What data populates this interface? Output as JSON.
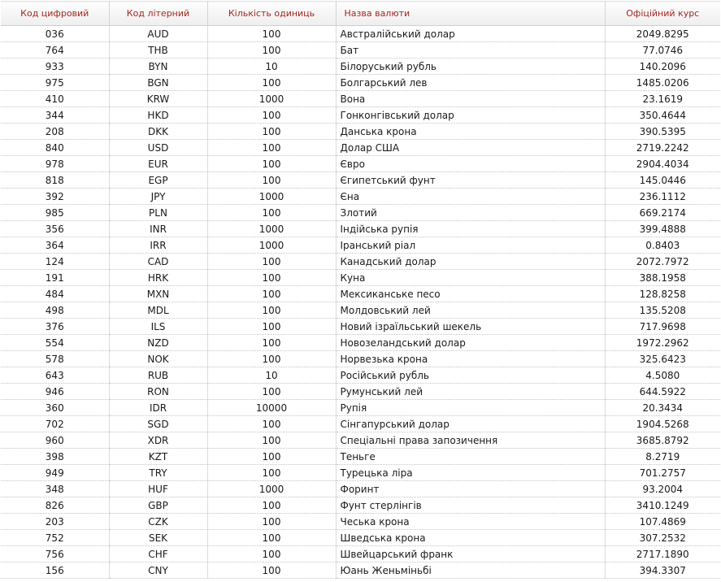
{
  "table": {
    "headers": [
      "Код цифровий",
      "Код літерний",
      "Кількість одиниць",
      "Назва валюти",
      "Офіційний курс"
    ],
    "rows": [
      [
        "036",
        "AUD",
        "100",
        "Австралійський долар",
        "2049.8295"
      ],
      [
        "764",
        "THB",
        "100",
        "Бат",
        "77.0746"
      ],
      [
        "933",
        "BYN",
        "10",
        "Білоруський рубль",
        "140.2096"
      ],
      [
        "975",
        "BGN",
        "100",
        "Болгарський лев",
        "1485.0206"
      ],
      [
        "410",
        "KRW",
        "1000",
        "Вона",
        "23.1619"
      ],
      [
        "344",
        "HKD",
        "100",
        "Гонконгівський долар",
        "350.4644"
      ],
      [
        "208",
        "DKK",
        "100",
        "Данська крона",
        "390.5395"
      ],
      [
        "840",
        "USD",
        "100",
        "Долар США",
        "2719.2242"
      ],
      [
        "978",
        "EUR",
        "100",
        "Євро",
        "2904.4034"
      ],
      [
        "818",
        "EGP",
        "100",
        "Єгипетський фунт",
        "145.0446"
      ],
      [
        "392",
        "JPY",
        "1000",
        "Єна",
        "236.1112"
      ],
      [
        "985",
        "PLN",
        "100",
        "Злотий",
        "669.2174"
      ],
      [
        "356",
        "INR",
        "1000",
        "Індійська рупія",
        "399.4888"
      ],
      [
        "364",
        "IRR",
        "1000",
        "Іранський ріал",
        "0.8403"
      ],
      [
        "124",
        "CAD",
        "100",
        "Канадський долар",
        "2072.7972"
      ],
      [
        "191",
        "HRK",
        "100",
        "Куна",
        "388.1958"
      ],
      [
        "484",
        "MXN",
        "100",
        "Мексиканське песо",
        "128.8258"
      ],
      [
        "498",
        "MDL",
        "100",
        "Молдовський лей",
        "135.5208"
      ],
      [
        "376",
        "ILS",
        "100",
        "Новий ізраїльський шекель",
        "717.9698"
      ],
      [
        "554",
        "NZD",
        "100",
        "Новозеландський долар",
        "1972.2962"
      ],
      [
        "578",
        "NOK",
        "100",
        "Норвезька крона",
        "325.6423"
      ],
      [
        "643",
        "RUB",
        "10",
        "Російський рубль",
        "4.5080"
      ],
      [
        "946",
        "RON",
        "100",
        "Румунський лей",
        "644.5922"
      ],
      [
        "360",
        "IDR",
        "10000",
        "Рупія",
        "20.3434"
      ],
      [
        "702",
        "SGD",
        "100",
        "Сінгапурський долар",
        "1904.5268"
      ],
      [
        "960",
        "XDR",
        "100",
        "Спеціальні права запозичення",
        "3685.8792"
      ],
      [
        "398",
        "KZT",
        "100",
        "Теньге",
        "8.2719"
      ],
      [
        "949",
        "TRY",
        "100",
        "Турецька ліра",
        "701.2757"
      ],
      [
        "348",
        "HUF",
        "1000",
        "Форинт",
        "93.2004"
      ],
      [
        "826",
        "GBP",
        "100",
        "Фунт стерлінгів",
        "3410.1249"
      ],
      [
        "203",
        "CZK",
        "100",
        "Чеська крона",
        "107.4869"
      ],
      [
        "752",
        "SEK",
        "100",
        "Шведська крона",
        "307.2532"
      ],
      [
        "756",
        "CHF",
        "100",
        "Швейцарський франк",
        "2717.1890"
      ],
      [
        "156",
        "CNY",
        "100",
        "Юань Женьміньбі",
        "394.3307"
      ]
    ]
  },
  "colors": {
    "header_text": "#a8261f",
    "cell_text": "#1a1a1a"
  }
}
